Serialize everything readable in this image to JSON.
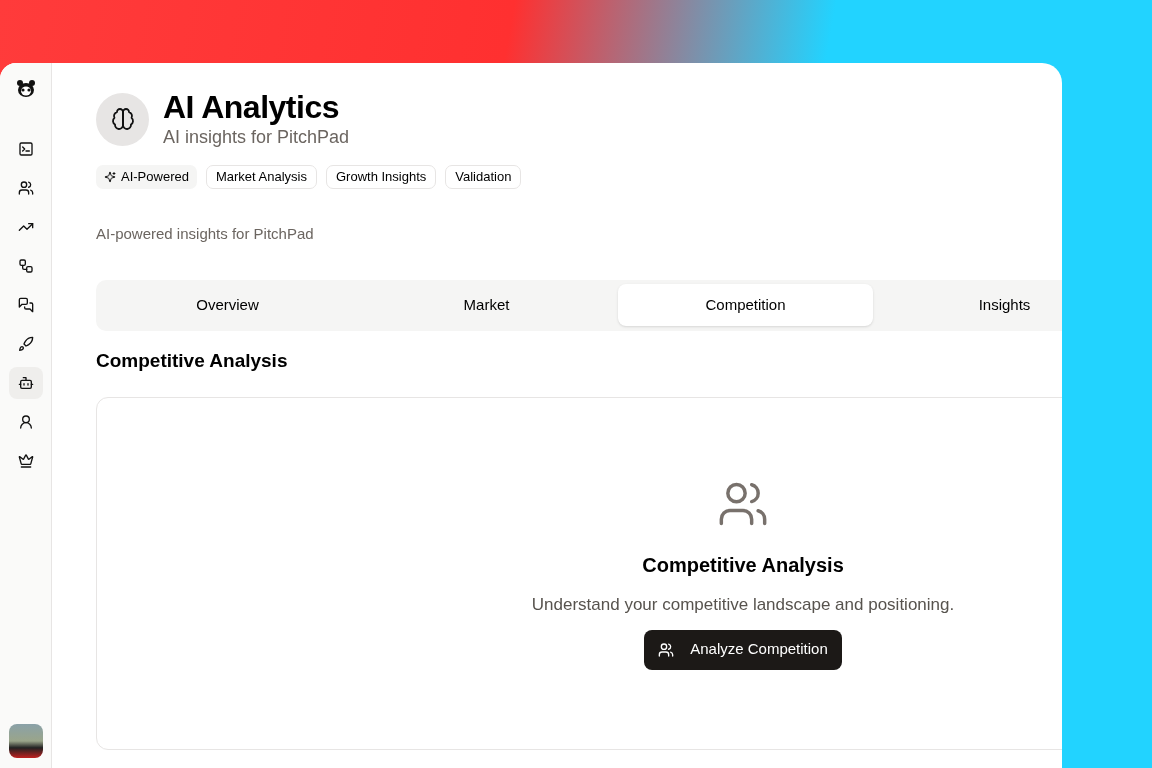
{
  "sidebar": {
    "items": [
      {
        "selected": false
      },
      {
        "selected": false
      },
      {
        "selected": false
      },
      {
        "selected": false
      },
      {
        "selected": false
      },
      {
        "selected": false
      },
      {
        "selected": true
      },
      {
        "selected": false
      },
      {
        "selected": false
      }
    ]
  },
  "header": {
    "title": "AI Analytics",
    "subtitle": "AI insights for PitchPad"
  },
  "tags": [
    {
      "label": "AI-Powered",
      "kind": "highlight"
    },
    {
      "label": "Market Analysis",
      "kind": "outline"
    },
    {
      "label": "Growth Insights",
      "kind": "outline"
    },
    {
      "label": "Validation",
      "kind": "outline"
    }
  ],
  "description": "AI-powered insights for PitchPad",
  "tabs": [
    {
      "label": "Overview",
      "selected": false
    },
    {
      "label": "Market",
      "selected": false
    },
    {
      "label": "Competition",
      "selected": true
    },
    {
      "label": "Insights",
      "selected": false
    }
  ],
  "section_title": "Competitive Analysis",
  "empty_state": {
    "title": "Competitive Analysis",
    "text": "Understand your competitive landscape and positioning.",
    "button": "Analyze Competition"
  }
}
